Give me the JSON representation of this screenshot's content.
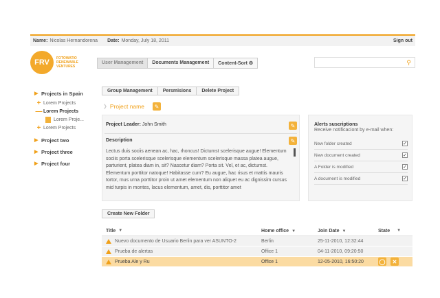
{
  "topbar": {
    "name_label": "Name:",
    "name_value": "Nicolas Hernandorena",
    "date_label": "Date:",
    "date_value": "Monday, July 18, 2011",
    "signout": "Sign out"
  },
  "logo": {
    "mark": "FRV",
    "line1": "FOTOWATIO",
    "line2": "RENEWABLE",
    "line3": "VENTURES"
  },
  "mainnav": [
    "User Management",
    "Documents Management",
    "Content-Sort ⚙"
  ],
  "search": {
    "placeholder": "",
    "icon": "search-icon"
  },
  "sidebar": {
    "projects": [
      "Projects in Spain",
      "Project two",
      "Project three",
      "Project four"
    ],
    "sub": [
      "Lorem Projects",
      "Lorem Projects",
      "Lorem Proje...",
      "Lorem Projects"
    ]
  },
  "tabs": [
    "Group Management",
    "Persmisions",
    "Delete Project"
  ],
  "project": {
    "name": "Project name",
    "leader_label": "Project Leader:",
    "leader_value": "John Smith",
    "desc_title": "Description",
    "desc_text": "Lectus duis sociis aenean ac, hac, rhoncus! Dictumst scelerisque augue! Elementum sociis porta scelerisque scelerisque elementum scelerisque massa platea augue, parturient, platea diam in, sit? Nascetur diam? Porta sit. Vel, et ac, dictumst. Elementum porttitor natoque! Habitasse cum? Eu augue, hac risus et mattis mauris tortor, mus urna porttitor proin ut amet elementum non aliquet eu ac dignissim cursus mid turpis in montes, lacus elementum, amet, dis, porttitor amet"
  },
  "alerts": {
    "title": "Alerts suscriptions",
    "subtitle": "Receive notificaciont by e-mail when:",
    "items": [
      "New folder created",
      "New document created",
      "A Folder is modified",
      "A document is modified"
    ]
  },
  "new_folder": "Create New Folder",
  "table": {
    "headers": [
      "Title",
      "Home office",
      "Join Date",
      "State"
    ],
    "rows": [
      {
        "title": "Nuevo documento de Usuario Berlin para ver ASUNTO-2",
        "office": "Berlin",
        "date": "25-11-2010, 12:32:44"
      },
      {
        "title": "Prueba de alertas",
        "office": "Office 1",
        "date": "04-11-2010, 09:20:50"
      },
      {
        "title": "Prueba Ale y Ru",
        "office": "Office 1",
        "date": "12-05-2010, 16:50:20"
      }
    ]
  },
  "colors": {
    "accent": "#f0a019",
    "selected_row": "#fbdba2",
    "panel": "#f5f5f5"
  }
}
